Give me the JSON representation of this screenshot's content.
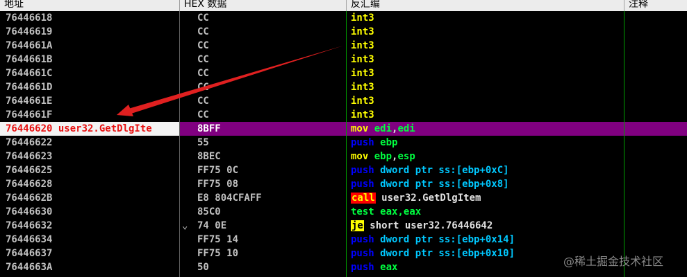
{
  "columns": {
    "address": "地址",
    "hex": "HEX 数据",
    "disasm": "反汇编",
    "comment": "注释"
  },
  "colors": {
    "selected_row": "#800080",
    "address_text": "#c0c0c0",
    "selected_address_text": "#e81010",
    "arrow": "#e02020"
  },
  "rows": [
    {
      "address": "76446618",
      "hex": "CC",
      "mnemonic": "int3",
      "mclass": "kw-int",
      "operands": []
    },
    {
      "address": "76446619",
      "hex": "CC",
      "mnemonic": "int3",
      "mclass": "kw-int",
      "operands": []
    },
    {
      "address": "7644661A",
      "hex": "CC",
      "mnemonic": "int3",
      "mclass": "kw-int",
      "operands": []
    },
    {
      "address": "7644661B",
      "hex": "CC",
      "mnemonic": "int3",
      "mclass": "kw-int",
      "operands": []
    },
    {
      "address": "7644661C",
      "hex": "CC",
      "mnemonic": "int3",
      "mclass": "kw-int",
      "operands": []
    },
    {
      "address": "7644661D",
      "hex": "CC",
      "mnemonic": "int3",
      "mclass": "kw-int",
      "operands": []
    },
    {
      "address": "7644661E",
      "hex": "CC",
      "mnemonic": "int3",
      "mclass": "kw-int",
      "operands": []
    },
    {
      "address": "7644661F",
      "hex": "CC",
      "mnemonic": "int3",
      "mclass": "kw-int",
      "operands": []
    },
    {
      "address": "76446620 user32.GetDlgIte",
      "hex": "8BFF",
      "mnemonic": "mov",
      "mclass": "kw-mov",
      "selected": true,
      "operands": [
        {
          "t": " "
        },
        {
          "t": "edi",
          "c": "op-reg"
        },
        {
          "t": ","
        },
        {
          "t": "edi",
          "c": "op-reg"
        }
      ]
    },
    {
      "address": "76446622",
      "hex": "55",
      "mnemonic": "push",
      "mclass": "kw-push",
      "operands": [
        {
          "t": " "
        },
        {
          "t": "ebp",
          "c": "op-reg"
        }
      ]
    },
    {
      "address": "76446623",
      "hex": "8BEC",
      "mnemonic": "mov",
      "mclass": "kw-mov",
      "operands": [
        {
          "t": " "
        },
        {
          "t": "ebp",
          "c": "op-reg"
        },
        {
          "t": ","
        },
        {
          "t": "esp",
          "c": "op-reg"
        }
      ]
    },
    {
      "address": "76446625",
      "hex": "FF75 0C",
      "mnemonic": "push",
      "mclass": "kw-push",
      "operands": [
        {
          "t": " dword ptr ss:[ebp+0xC]",
          "c": "op-mem"
        }
      ]
    },
    {
      "address": "76446628",
      "hex": "FF75 08",
      "mnemonic": "push",
      "mclass": "kw-push",
      "operands": [
        {
          "t": " dword ptr ss:[ebp+0x8]",
          "c": "op-mem"
        }
      ]
    },
    {
      "address": "7644662B",
      "hex": "E8 804CFAFF",
      "mnemonic": "call",
      "mclass": "kw-call",
      "operands": [
        {
          "t": " user32.GetDlgItem",
          "c": "op-plain"
        }
      ]
    },
    {
      "address": "76446630",
      "hex": "85C0",
      "mnemonic": "test",
      "mclass": "kw-test",
      "operands": [
        {
          "t": " "
        },
        {
          "t": "eax",
          "c": "op-reg"
        },
        {
          "t": ",",
          "c": "op-reg"
        },
        {
          "t": "eax",
          "c": "op-reg"
        }
      ]
    },
    {
      "address": "76446632",
      "hex": "74 0E",
      "mnemonic": "je",
      "mclass": "kw-je",
      "jump_mark": "⌄",
      "operands": [
        {
          "t": " short user32.76446642",
          "c": "op-plain"
        }
      ]
    },
    {
      "address": "76446634",
      "hex": "FF75 14",
      "mnemonic": "push",
      "mclass": "kw-push",
      "operands": [
        {
          "t": " dword ptr ss:[ebp+0x14]",
          "c": "op-mem"
        }
      ]
    },
    {
      "address": "76446637",
      "hex": "FF75 10",
      "mnemonic": "push",
      "mclass": "kw-push",
      "operands": [
        {
          "t": " dword ptr ss:[ebp+0x10]",
          "c": "op-mem"
        }
      ]
    },
    {
      "address": "7644663A",
      "hex": "50",
      "mnemonic": "push",
      "mclass": "kw-push",
      "operands": [
        {
          "t": " "
        },
        {
          "t": "eax",
          "c": "op-reg"
        }
      ]
    }
  ],
  "watermark": "@稀土掘金技术社区"
}
